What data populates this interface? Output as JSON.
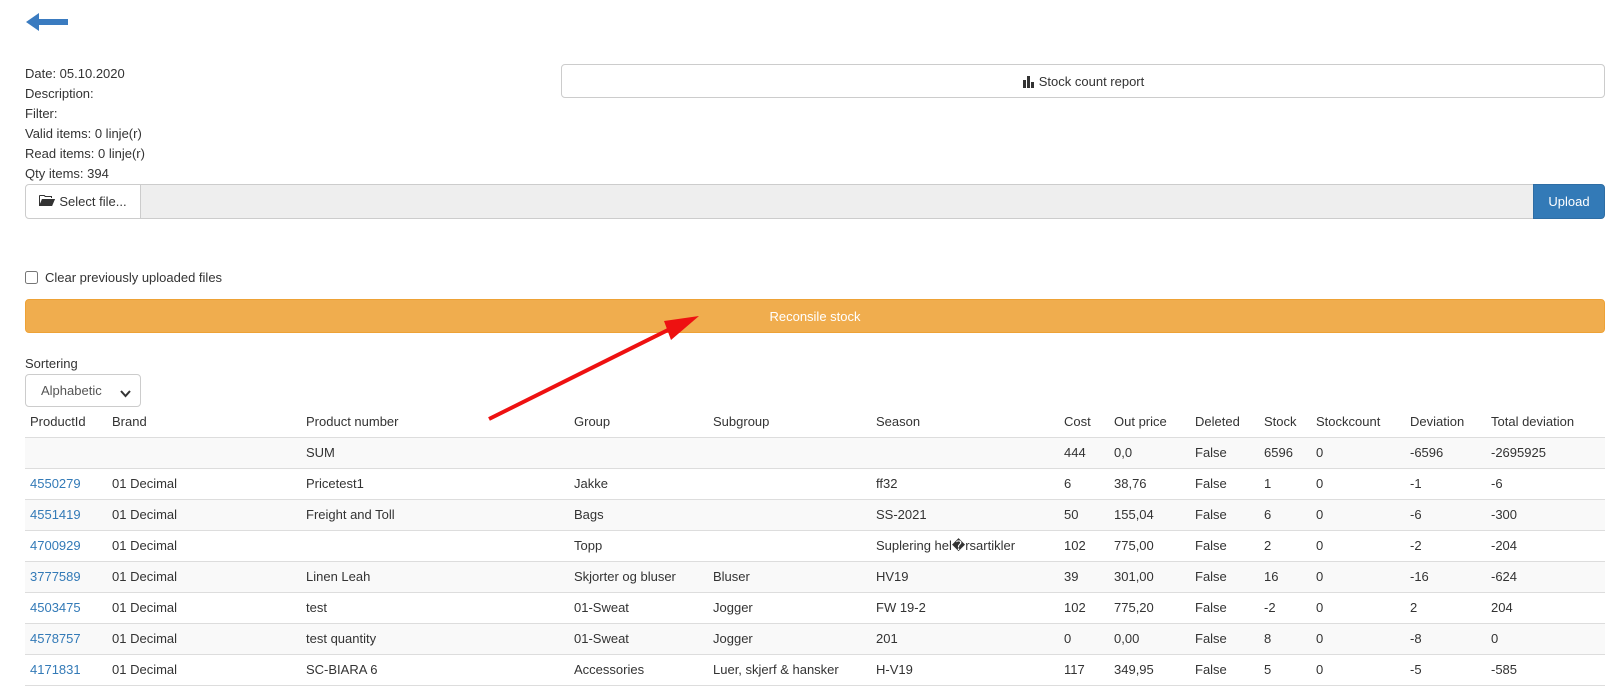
{
  "info": {
    "date": "Date: 05.10.2020",
    "description": "Description:",
    "filter": "Filter:",
    "valid_items": "Valid items: 0 linje(r)",
    "read_items": "Read items: 0 linje(r)",
    "qty_items": "Qty items: 394"
  },
  "report_button": "Stock count report",
  "file_upload": {
    "select_label": "Select file...",
    "file_name": "",
    "upload_label": "Upload"
  },
  "clear_checkbox": {
    "label": "Clear previously uploaded files",
    "checked": false
  },
  "reconcile_button": "Reconsile stock",
  "sorting": {
    "label": "Sortering",
    "selected": "Alphabetic"
  },
  "colors": {
    "primary": "#337ab7",
    "warning": "#f0ad4e",
    "annotation": "#ee1111"
  },
  "table": {
    "headers": [
      "ProductId",
      "Brand",
      "Product number",
      "Group",
      "Subgroup",
      "Season",
      "Cost",
      "Out price",
      "Deleted",
      "Stock",
      "Stockcount",
      "Deviation",
      "Total deviation"
    ],
    "sum_row": [
      "",
      "",
      "SUM",
      "",
      "",
      "",
      "444",
      "0,0",
      "False",
      "6596",
      "0",
      "-6596",
      "-2695925"
    ],
    "rows": [
      [
        "4550279",
        "01 Decimal",
        "Pricetest1",
        "Jakke",
        "",
        "ff32",
        "6",
        "38,76",
        "False",
        "1",
        "0",
        "-1",
        "-6"
      ],
      [
        "4551419",
        "01 Decimal",
        "Freight and Toll",
        "Bags",
        "",
        "SS-2021",
        "50",
        "155,04",
        "False",
        "6",
        "0",
        "-6",
        "-300"
      ],
      [
        "4700929",
        "01 Decimal",
        "",
        "Topp",
        "",
        "Suplering hel�rsartikler",
        "102",
        "775,00",
        "False",
        "2",
        "0",
        "-2",
        "-204"
      ],
      [
        "3777589",
        "01 Decimal",
        "Linen Leah",
        "Skjorter og bluser",
        "Bluser",
        "HV19",
        "39",
        "301,00",
        "False",
        "16",
        "0",
        "-16",
        "-624"
      ],
      [
        "4503475",
        "01 Decimal",
        "test",
        "01-Sweat",
        "Jogger",
        "FW 19-2",
        "102",
        "775,20",
        "False",
        "-2",
        "0",
        "2",
        "204"
      ],
      [
        "4578757",
        "01 Decimal",
        "test quantity",
        "01-Sweat",
        "Jogger",
        "201",
        "0",
        "0,00",
        "False",
        "8",
        "0",
        "-8",
        "0"
      ],
      [
        "4171831",
        "01 Decimal",
        "SC-BIARA 6",
        "Accessories",
        "Luer, skjerf & hansker",
        "H-V19",
        "117",
        "349,95",
        "False",
        "5",
        "0",
        "-5",
        "-585"
      ]
    ]
  }
}
